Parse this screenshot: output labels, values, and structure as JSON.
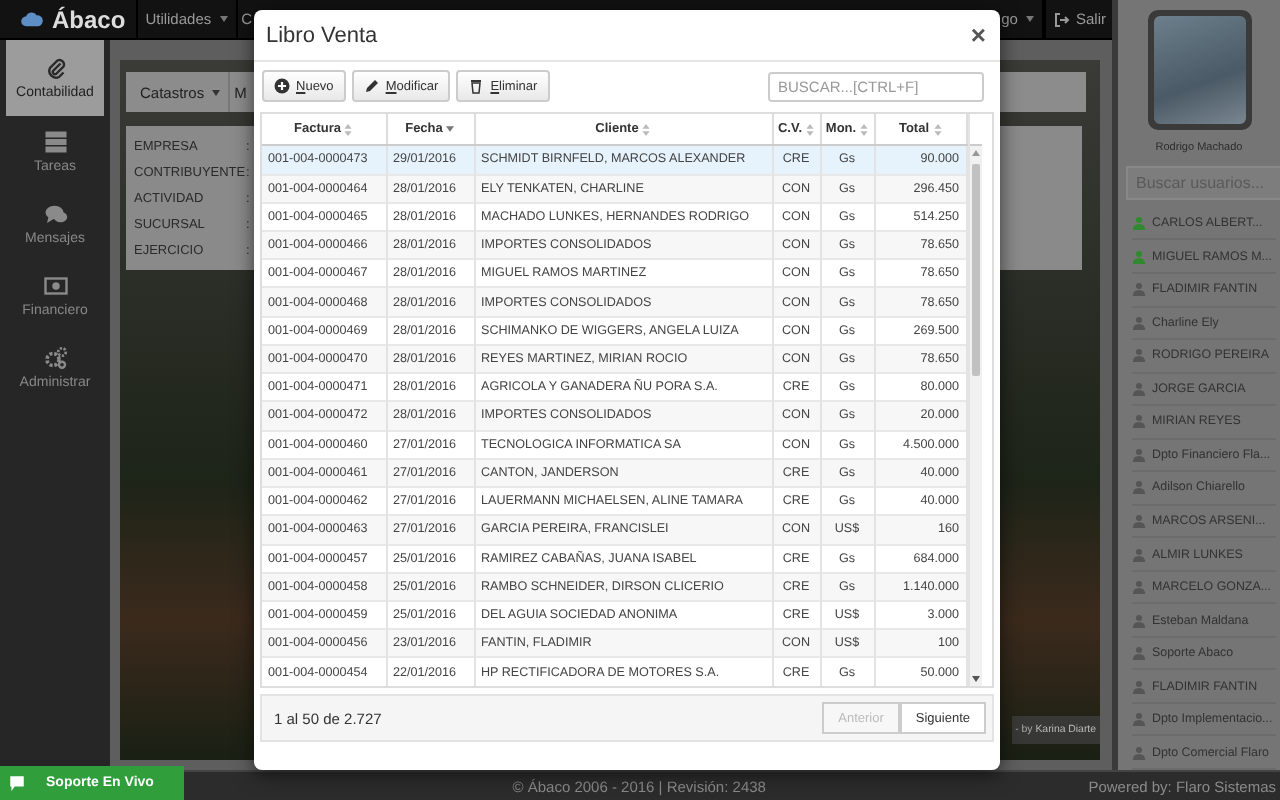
{
  "nav": {
    "brand": "Ábaco",
    "menus": [
      "Utilidades"
    ],
    "partial_menu": "C",
    "right_menus": [
      "go"
    ],
    "logout": "Salir"
  },
  "sidebar": {
    "items": [
      {
        "label": "Contabilidad",
        "selected": true
      },
      {
        "label": "Tareas",
        "selected": false
      },
      {
        "label": "Mensajes",
        "selected": false
      },
      {
        "label": "Financiero",
        "selected": false
      },
      {
        "label": "Administrar",
        "selected": false
      }
    ]
  },
  "workspace": {
    "menu": [
      "Catastros"
    ],
    "partial_menu": "M",
    "info_rows": [
      {
        "label": "EMPRESA",
        "colon": ":"
      },
      {
        "label": "CONTRIBUYENTE",
        "colon": ":"
      },
      {
        "label": "ACTIVIDAD",
        "colon": ":"
      },
      {
        "label": "SUCURSAL",
        "colon": ":"
      },
      {
        "label": "EJERCICIO",
        "colon": ":"
      }
    ],
    "photo_credit": {
      "text": "- by",
      "link": "Karina Diarte"
    }
  },
  "profile": {
    "name": "Rodrigo Machado",
    "search": {
      "placeholder": "Buscar usuarios..."
    },
    "users": [
      {
        "name": "CARLOS ALBERT...",
        "online": true
      },
      {
        "name": "MIGUEL RAMOS M...",
        "online": true
      },
      {
        "name": "FLADIMIR FANTIN",
        "online": false
      },
      {
        "name": "Charline Ely",
        "online": false
      },
      {
        "name": "RODRIGO PEREIRA",
        "online": false
      },
      {
        "name": "JORGE GARCIA",
        "online": false
      },
      {
        "name": "MIRIAN REYES",
        "online": false
      },
      {
        "name": "Dpto Financiero Fla...",
        "online": false
      },
      {
        "name": "Adilson Chiarello",
        "online": false
      },
      {
        "name": "MARCOS ARSENI...",
        "online": false
      },
      {
        "name": "ALMIR LUNKES",
        "online": false
      },
      {
        "name": "MARCELO GONZA...",
        "online": false
      },
      {
        "name": "Esteban Maldana",
        "online": false
      },
      {
        "name": "Soporte Abaco",
        "online": false
      },
      {
        "name": "FLADIMIR FANTIN",
        "online": false
      },
      {
        "name": "Dpto Implementacio...",
        "online": false
      },
      {
        "name": "Dpto Comercial Flaro",
        "online": false
      }
    ]
  },
  "footer": {
    "copyright": "© Ábaco 2006 - 2016 | Revisión: 2438",
    "powered": "Powered by: Flaro Sistemas"
  },
  "support": {
    "label": "Soporte En Vivo"
  },
  "dialog": {
    "title": "Libro Venta",
    "close": "×",
    "toolbar": [
      "Nuevo",
      "Modificar",
      "Eliminar"
    ],
    "search": {
      "placeholder": "BUSCAR...[CTRL+F]"
    },
    "columns": [
      {
        "label": "Factura",
        "sorted": false
      },
      {
        "label": "Fecha",
        "sorted": true
      },
      {
        "label": "Cliente",
        "sorted": false
      },
      {
        "label": "C.V.",
        "sorted": false
      },
      {
        "label": "Mon.",
        "sorted": false
      },
      {
        "label": "Total",
        "sorted": false
      }
    ],
    "rows": [
      {
        "factura": "001-004-0000473",
        "fecha": "29/01/2016",
        "cliente": "SCHMIDT BIRNFELD, MARCOS ALEXANDER",
        "cv": "CRE",
        "moneda": "Gs",
        "total": "90.000",
        "selected": true
      },
      {
        "factura": "001-004-0000464",
        "fecha": "28/01/2016",
        "cliente": "ELY TENKATEN, CHARLINE",
        "cv": "CON",
        "moneda": "Gs",
        "total": "296.450",
        "selected": false
      },
      {
        "factura": "001-004-0000465",
        "fecha": "28/01/2016",
        "cliente": "MACHADO LUNKES, HERNANDES RODRIGO",
        "cv": "CON",
        "moneda": "Gs",
        "total": "514.250",
        "selected": false
      },
      {
        "factura": "001-004-0000466",
        "fecha": "28/01/2016",
        "cliente": "IMPORTES CONSOLIDADOS",
        "cv": "CON",
        "moneda": "Gs",
        "total": "78.650",
        "selected": false
      },
      {
        "factura": "001-004-0000467",
        "fecha": "28/01/2016",
        "cliente": "MIGUEL RAMOS MARTINEZ",
        "cv": "CON",
        "moneda": "Gs",
        "total": "78.650",
        "selected": false
      },
      {
        "factura": "001-004-0000468",
        "fecha": "28/01/2016",
        "cliente": "IMPORTES CONSOLIDADOS",
        "cv": "CON",
        "moneda": "Gs",
        "total": "78.650",
        "selected": false
      },
      {
        "factura": "001-004-0000469",
        "fecha": "28/01/2016",
        "cliente": "SCHIMANKO DE WIGGERS, ANGELA LUIZA",
        "cv": "CON",
        "moneda": "Gs",
        "total": "269.500",
        "selected": false
      },
      {
        "factura": "001-004-0000470",
        "fecha": "28/01/2016",
        "cliente": "REYES MARTINEZ, MIRIAN ROCIO",
        "cv": "CON",
        "moneda": "Gs",
        "total": "78.650",
        "selected": false
      },
      {
        "factura": "001-004-0000471",
        "fecha": "28/01/2016",
        "cliente": "AGRICOLA Y GANADERA ÑU PORA S.A.",
        "cv": "CRE",
        "moneda": "Gs",
        "total": "80.000",
        "selected": false
      },
      {
        "factura": "001-004-0000472",
        "fecha": "28/01/2016",
        "cliente": "IMPORTES CONSOLIDADOS",
        "cv": "CON",
        "moneda": "Gs",
        "total": "20.000",
        "selected": false
      },
      {
        "factura": "001-004-0000460",
        "fecha": "27/01/2016",
        "cliente": "TECNOLOGICA INFORMATICA SA",
        "cv": "CON",
        "moneda": "Gs",
        "total": "4.500.000",
        "selected": false
      },
      {
        "factura": "001-004-0000461",
        "fecha": "27/01/2016",
        "cliente": "CANTON, JANDERSON",
        "cv": "CRE",
        "moneda": "Gs",
        "total": "40.000",
        "selected": false
      },
      {
        "factura": "001-004-0000462",
        "fecha": "27/01/2016",
        "cliente": "LAUERMANN MICHAELSEN, ALINE TAMARA",
        "cv": "CRE",
        "moneda": "Gs",
        "total": "40.000",
        "selected": false
      },
      {
        "factura": "001-004-0000463",
        "fecha": "27/01/2016",
        "cliente": "GARCIA PEREIRA, FRANCISLEI",
        "cv": "CON",
        "moneda": "US$",
        "total": "160",
        "selected": false
      },
      {
        "factura": "001-004-0000457",
        "fecha": "25/01/2016",
        "cliente": "RAMIREZ CABAÑAS, JUANA ISABEL",
        "cv": "CRE",
        "moneda": "Gs",
        "total": "684.000",
        "selected": false
      },
      {
        "factura": "001-004-0000458",
        "fecha": "25/01/2016",
        "cliente": "RAMBO SCHNEIDER, DIRSON CLICERIO",
        "cv": "CRE",
        "moneda": "Gs",
        "total": "1.140.000",
        "selected": false
      },
      {
        "factura": "001-004-0000459",
        "fecha": "25/01/2016",
        "cliente": "DEL AGUIA SOCIEDAD ANONIMA",
        "cv": "CRE",
        "moneda": "US$",
        "total": "3.000",
        "selected": false
      },
      {
        "factura": "001-004-0000456",
        "fecha": "23/01/2016",
        "cliente": "FANTIN, FLADIMIR",
        "cv": "CON",
        "moneda": "US$",
        "total": "100",
        "selected": false
      },
      {
        "factura": "001-004-0000454",
        "fecha": "22/01/2016",
        "cliente": "HP RECTIFICADORA DE MOTORES S.A.",
        "cv": "CRE",
        "moneda": "Gs",
        "total": "50.000",
        "selected": false
      }
    ],
    "pagination": {
      "summary": "1 al 50 de 2.727",
      "buttons": [
        {
          "label": "Anterior",
          "disabled": true
        },
        {
          "label": "Siguiente",
          "disabled": false
        }
      ]
    }
  }
}
